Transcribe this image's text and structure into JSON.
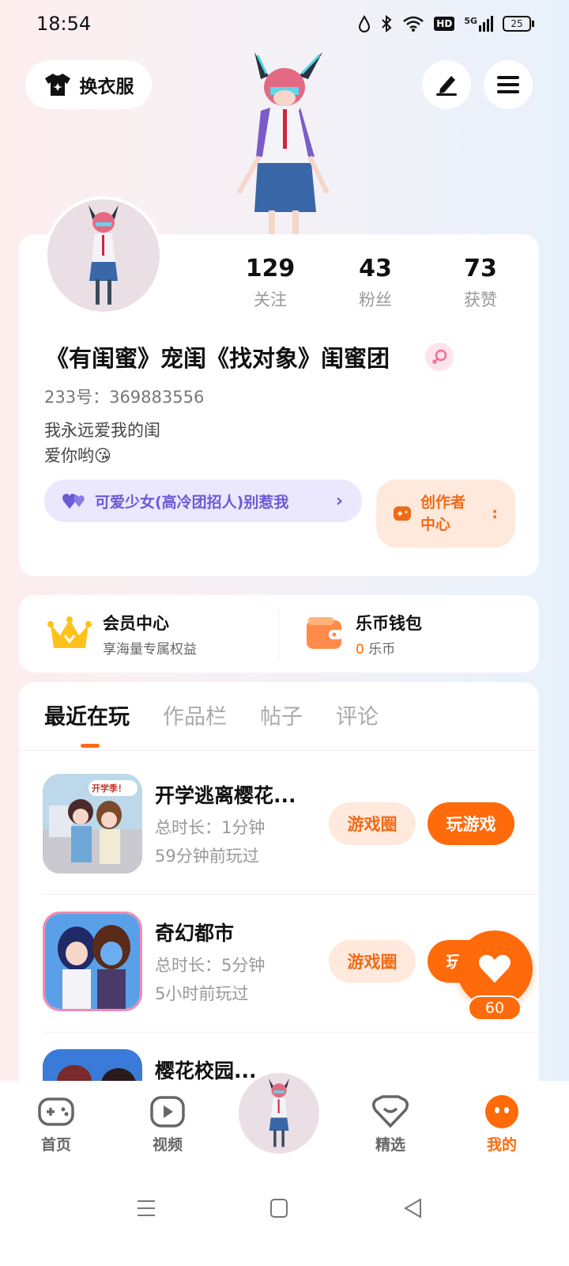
{
  "status_bar": {
    "time": "18:54",
    "battery": "25",
    "network": "5G",
    "hd": "HD"
  },
  "header": {
    "outfit_label": "换衣服"
  },
  "profile": {
    "stats": [
      {
        "value": "129",
        "label": "关注"
      },
      {
        "value": "43",
        "label": "粉丝"
      },
      {
        "value": "73",
        "label": "获赞"
      }
    ],
    "nickname": "《有闺蜜》宠闺《找对象》闺蜜团",
    "uid": "233号：369883556",
    "bio_line1": "我永远爱我的闺",
    "bio_line2": "爱你哟😘",
    "group_label": "可爱少女(高冷团招人)别惹我",
    "creator_label_1": "创作者",
    "creator_label_2": "中心"
  },
  "vip": {
    "member_title": "会员中心",
    "member_sub": "享海量专属权益",
    "wallet_title": "乐币钱包",
    "wallet_amount": "0",
    "wallet_unit": "乐币"
  },
  "tabs": [
    "最近在玩",
    "作品栏",
    "帖子",
    "评论"
  ],
  "games": [
    {
      "name": "开学逃离樱花...",
      "duration": "总时长：1分钟",
      "last_played": "59分钟前玩过",
      "circle_label": "游戏圈",
      "play_label": "玩游戏",
      "sticker": "开学季！"
    },
    {
      "name": "奇幻都市",
      "duration": "总时长：5分钟",
      "last_played": "5小时前玩过",
      "circle_label": "游戏圈",
      "play_label": "玩游戏"
    },
    {
      "name": "樱花校园..."
    }
  ],
  "float": {
    "like_count": "60"
  },
  "bottom_nav": {
    "home": "首页",
    "video": "视频",
    "featured": "精选",
    "mine": "我的"
  },
  "colors": {
    "accent": "#ff6a0a",
    "light_accent": "#fee9dc",
    "purple": "#6b5bd6"
  }
}
